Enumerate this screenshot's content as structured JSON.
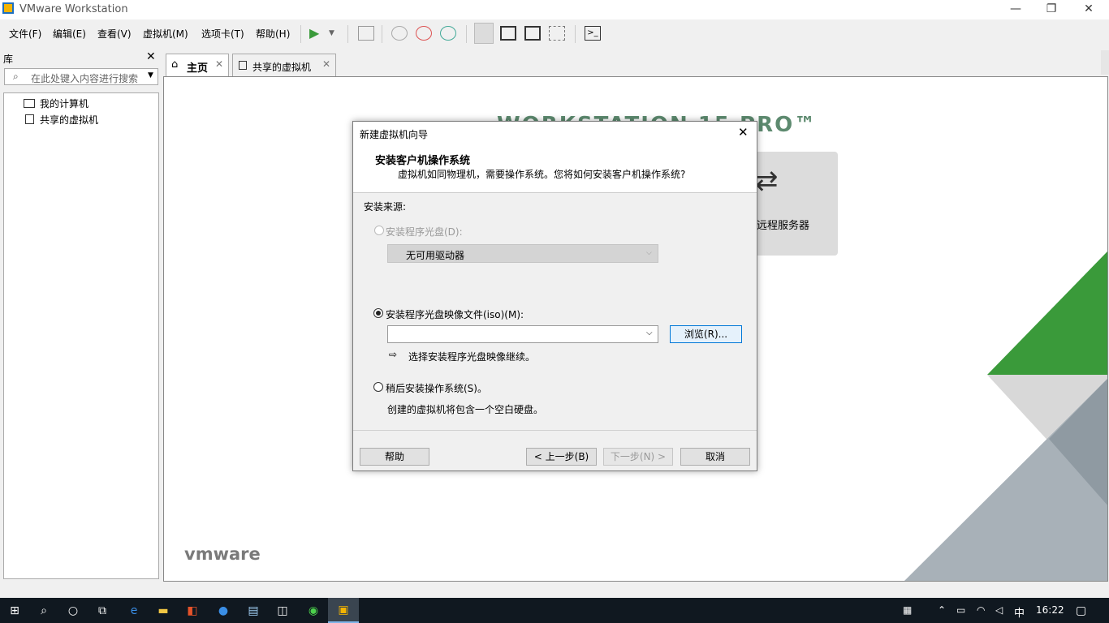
{
  "window": {
    "title": "VMware Workstation"
  },
  "menu": [
    "文件(F)",
    "编辑(E)",
    "查看(V)",
    "虚拟机(M)",
    "选项卡(T)",
    "帮助(H)"
  ],
  "library": {
    "title": "库",
    "search_placeholder": "在此处键入内容进行搜索",
    "items": [
      "我的计算机",
      "共享的虚拟机"
    ]
  },
  "tabs": [
    {
      "label": "主页"
    },
    {
      "label": "共享的虚拟机"
    }
  ],
  "home": {
    "banner": "WORKSTATION 15 PRO™",
    "remote_server_label": "远程服务器",
    "brand": "vmware"
  },
  "dialog": {
    "title": "新建虚拟机向导",
    "heading": "安装客户机操作系统",
    "subheading": "虚拟机如同物理机，需要操作系统。您将如何安装客户机操作系统?",
    "source_label": "安装来源:",
    "option_disc": "安装程序光盘(D):",
    "disc_select_value": "无可用驱动器",
    "option_iso": "安装程序光盘映像文件(iso)(M):",
    "iso_value": "",
    "browse_label": "浏览(R)...",
    "iso_hint": "选择安装程序光盘映像继续。",
    "option_later": "稍后安装操作系统(S)。",
    "later_desc": "创建的虚拟机将包含一个空白硬盘。",
    "help_label": "帮助",
    "back_label": "< 上一步(B)",
    "next_label": "下一步(N) >",
    "cancel_label": "取消"
  },
  "taskbar": {
    "ime": "中",
    "time": "16:22"
  },
  "colors": {
    "accent_green": "#3a9a3a",
    "dialog_bg": "#f0f0f0",
    "taskbar": "#101820"
  }
}
